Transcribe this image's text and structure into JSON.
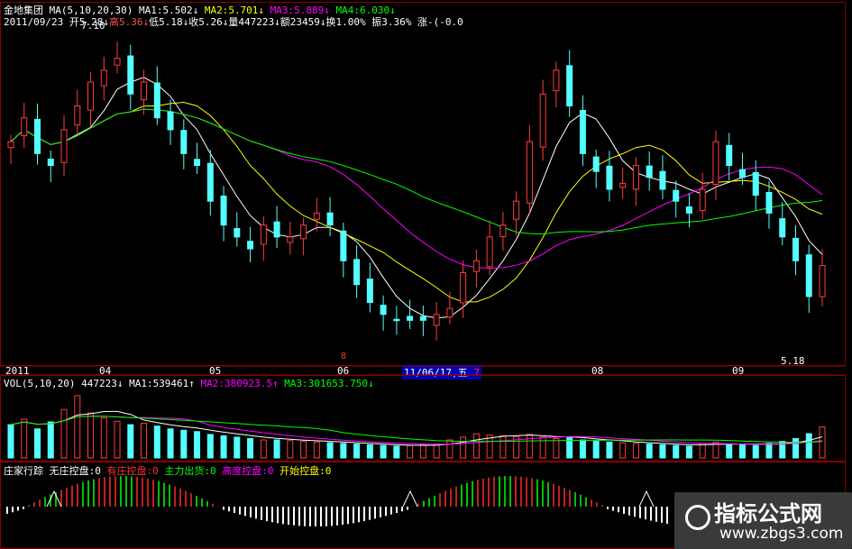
{
  "price_header": {
    "line1": [
      {
        "text": "金地集团",
        "color": "#ffffff"
      },
      {
        "text": " MA(5,10,20,30) ",
        "color": "#ffffff"
      },
      {
        "text": "MA1:5.502↓",
        "color": "#ffffff"
      },
      {
        "text": " MA2:5.701↓",
        "color": "#ffff00"
      },
      {
        "text": " MA3:5.889↓",
        "color": "#ff00ff"
      },
      {
        "text": " MA4:6.030↓",
        "color": "#00ff00"
      }
    ],
    "line2": [
      {
        "text": "2011/09/23",
        "color": "#ffffff"
      },
      {
        "text": " 开5.28↓",
        "color": "#ffffff"
      },
      {
        "text": "高5.36↓",
        "color": "#ff5050"
      },
      {
        "text": "低5.18↓",
        "color": "#ffffff"
      },
      {
        "text": "收5.26↓",
        "color": "#ffffff"
      },
      {
        "text": "量447223↓",
        "color": "#ffffff"
      },
      {
        "text": "额23459↓",
        "color": "#ffffff"
      },
      {
        "text": "换1.00%",
        "color": "#ffffff"
      },
      {
        "text": " 振3.36%",
        "color": "#ffffff"
      },
      {
        "text": " 涨-(-0.0",
        "color": "#ffffff"
      }
    ],
    "high_marker": "7.10",
    "low_marker": "5.18"
  },
  "time_axis": {
    "labels": [
      "2011",
      "04",
      "05",
      "06",
      "08",
      "09"
    ],
    "cursor_label": "11/06/17,五",
    "cursor_suffix": "7",
    "red_marker": "8"
  },
  "vol_header": [
    {
      "text": "VOL(5,10,20) ",
      "color": "#ffffff"
    },
    {
      "text": "447223↓",
      "color": "#ffffff"
    },
    {
      "text": " MA1:539461↑",
      "color": "#ffffff"
    },
    {
      "text": " MA2:380923.5↑",
      "color": "#ff00ff"
    },
    {
      "text": " MA3:301653.750↓",
      "color": "#00ff00"
    }
  ],
  "ind_header": [
    {
      "text": "庄家行踪",
      "color": "#ffffff"
    },
    {
      "text": " 无庄控盘:0",
      "color": "#ffffff"
    },
    {
      "text": " 有庄控盘:0",
      "color": "#ff3030"
    },
    {
      "text": " 主力出货:0",
      "color": "#00ff00"
    },
    {
      "text": " 高度控盘:0",
      "color": "#ff00ff"
    },
    {
      "text": " 开始控盘:0",
      "color": "#ffff00"
    }
  ],
  "watermark": {
    "title": "指标公式网",
    "url": "www.zbgs3.com"
  },
  "colors": {
    "up": "#ff3c3c",
    "down": "#54ffff",
    "ma1": "#ffffff",
    "ma2": "#ffff00",
    "ma3": "#ff00ff",
    "ma4": "#00ff00",
    "border": "#8b0000"
  },
  "chart_data": {
    "type": "candlestick",
    "close": [
      6.3,
      6.5,
      6.2,
      6.1,
      6.4,
      6.6,
      6.8,
      6.9,
      7.0,
      6.7,
      6.8,
      6.5,
      6.4,
      6.2,
      6.1,
      5.8,
      5.6,
      5.5,
      5.4,
      5.6,
      5.5,
      5.5,
      5.6,
      5.7,
      5.6,
      5.3,
      5.1,
      4.95,
      4.85,
      4.8,
      4.8,
      4.8,
      4.85,
      4.9,
      5.2,
      5.3,
      5.5,
      5.6,
      5.8,
      6.3,
      6.7,
      6.9,
      6.6,
      6.2,
      6.05,
      5.9,
      5.95,
      6.1,
      6.0,
      5.9,
      5.8,
      5.7,
      5.9,
      6.3,
      6.1,
      6.0,
      5.85,
      5.7,
      5.5,
      5.3,
      5.0,
      5.26
    ],
    "volume": [
      480000,
      560000,
      420000,
      520000,
      700000,
      900000,
      650000,
      580000,
      530000,
      480000,
      500000,
      460000,
      420000,
      400000,
      380000,
      340000,
      320000,
      300000,
      280000,
      260000,
      260000,
      250000,
      240000,
      230000,
      220000,
      210000,
      200000,
      190000,
      180000,
      170000,
      180000,
      190000,
      200000,
      260000,
      300000,
      350000,
      330000,
      320000,
      310000,
      340000,
      300000,
      280000,
      290000,
      260000,
      240000,
      230000,
      220000,
      210000,
      200000,
      190000,
      180000,
      170000,
      210000,
      230000,
      200000,
      190000,
      180000,
      210000,
      240000,
      280000,
      350000,
      447223
    ]
  }
}
